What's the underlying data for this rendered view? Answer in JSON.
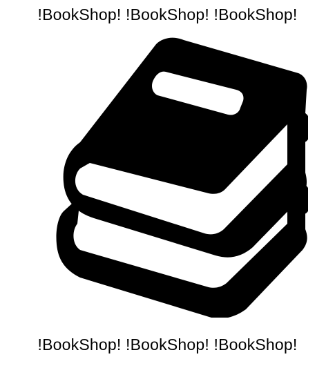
{
  "header": {
    "text": "!BookShop! !BookShop! !BookShop!"
  },
  "footer": {
    "text": "!BookShop! !BookShop! !BookShop!"
  },
  "logo": {
    "icon": "book-stack-icon",
    "color": "#000000",
    "page_color": "#ffffff"
  }
}
